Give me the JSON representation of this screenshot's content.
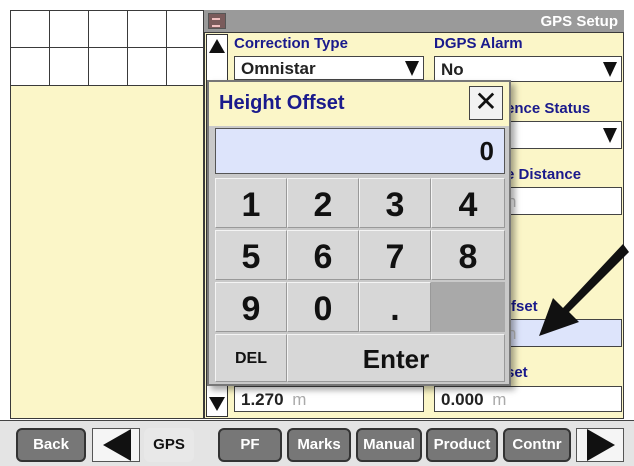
{
  "header": {
    "title": "GPS Setup"
  },
  "fields": {
    "correction_type": {
      "label": "Correction Type",
      "value": "Omnistar"
    },
    "dgps_alarm": {
      "label": "DGPS Alarm",
      "value": "No"
    },
    "difference_status": {
      "label": "ence Status"
    },
    "distance": {
      "label": "e Distance",
      "value": "n"
    },
    "offset_upper": {
      "label": "ffset",
      "value": "n"
    },
    "offset_lower": {
      "label": "set",
      "value": "0.000",
      "unit": "m"
    },
    "left_lower": {
      "value": "1.270",
      "unit": "m"
    }
  },
  "dialog": {
    "title": "Height Offset",
    "close_symbol": "✕",
    "display_value": "0",
    "keys": [
      "1",
      "2",
      "3",
      "4",
      "5",
      "6",
      "7",
      "8",
      "9",
      "0",
      "."
    ],
    "del_label": "DEL",
    "enter_label": "Enter"
  },
  "bottom_bar": {
    "back": "Back",
    "gps": "GPS",
    "pf": "PF",
    "marks": "Marks",
    "manual": "Manual",
    "product": "Product",
    "contnr": "Contnr"
  },
  "colors": {
    "panel_yellow": "#fbf6c8",
    "label_blue": "#1a1a8c",
    "field_blue": "#dde4fb",
    "button_gray": "#777777"
  }
}
